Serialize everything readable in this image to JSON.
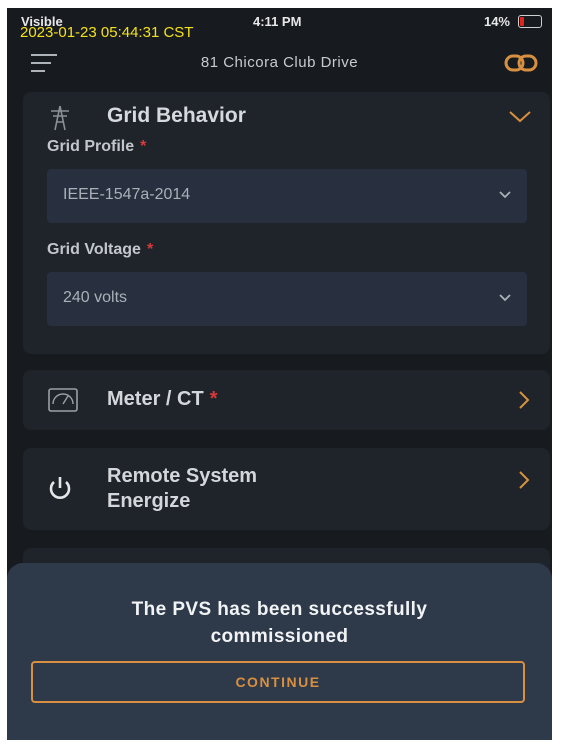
{
  "status_bar": {
    "carrier": "Visible",
    "time": "4:11 PM",
    "battery": "14%",
    "battery_color": "#e0251c"
  },
  "overlay_timestamp": "2023-01-23 05:44:31 CST",
  "header": {
    "site_name": "81 Chicora Club Drive",
    "menu_icon": "hamburger-menu-icon",
    "link_icon": "link-icon"
  },
  "grid_behavior": {
    "title": "Grid Behavior",
    "icon": "transmission-tower-icon",
    "profile_label": "Grid Profile",
    "profile_value": "IEEE-1547a-2014",
    "voltage_label": "Grid Voltage",
    "voltage_value": "240 volts",
    "required_mark": "*"
  },
  "meter": {
    "title": "Meter / CT",
    "icon": "meter-icon",
    "required_mark": "*"
  },
  "remote": {
    "title_line1": "Remote System",
    "title_line2": "Energize",
    "icon": "power-icon"
  },
  "dialog": {
    "message_line1": "The PVS has been successfully",
    "message_line2": "commissioned",
    "button": "CONTINUE"
  },
  "colors": {
    "accent": "#d89040",
    "required": "#d9393a",
    "background": "#171b20",
    "sheet": "#2e3a4a"
  }
}
